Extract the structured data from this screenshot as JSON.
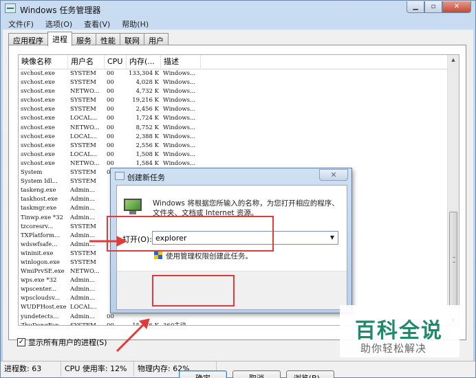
{
  "window": {
    "title": "Windows 任务管理器",
    "icon": "task-manager-icon"
  },
  "caption_buttons": [
    "▁",
    "▫",
    "✕"
  ],
  "menu": [
    "文件(F)",
    "选项(O)",
    "查看(V)",
    "帮助(H)"
  ],
  "tabs": [
    {
      "label": "应用程序",
      "active": false
    },
    {
      "label": "进程",
      "active": true
    },
    {
      "label": "服务",
      "active": false
    },
    {
      "label": "性能",
      "active": false
    },
    {
      "label": "联网",
      "active": false
    },
    {
      "label": "用户",
      "active": false
    }
  ],
  "columns": [
    "映像名称",
    "用户名",
    "CPU",
    "内存(...",
    "描述"
  ],
  "processes": [
    [
      "svchost.exe",
      "SYSTEM",
      "00",
      "133,304 K",
      "Windows..."
    ],
    [
      "svchost.exe",
      "SYSTEM",
      "00",
      "4,028 K",
      "Windows..."
    ],
    [
      "svchost.exe",
      "NETWO...",
      "00",
      "4,732 K",
      "Windows..."
    ],
    [
      "svchost.exe",
      "SYSTEM",
      "00",
      "19,216 K",
      "Windows..."
    ],
    [
      "svchost.exe",
      "SYSTEM",
      "00",
      "2,456 K",
      "Windows..."
    ],
    [
      "svchost.exe",
      "LOCAL...",
      "00",
      "1,724 K",
      "Windows..."
    ],
    [
      "svchost.exe",
      "NETWO...",
      "00",
      "8,752 K",
      "Windows..."
    ],
    [
      "svchost.exe",
      "LOCAL...",
      "00",
      "2,388 K",
      "Windows..."
    ],
    [
      "svchost.exe",
      "SYSTEM",
      "00",
      "2,556 K",
      "Windows..."
    ],
    [
      "svchost.exe",
      "LOCAL...",
      "00",
      "1,508 K",
      "Windows..."
    ],
    [
      "svchost.exe",
      "NETWO...",
      "00",
      "1,584 K",
      "Windows..."
    ],
    [
      "System",
      "SYSTEM",
      "00",
      "",
      ""
    ],
    [
      "System Idl...",
      "SYSTEM",
      "",
      "",
      ""
    ],
    [
      "taskeng.exe",
      "Admin...",
      "",
      "",
      ""
    ],
    [
      "taskhost.exe",
      "Admin...",
      "",
      "",
      ""
    ],
    [
      "taskmgr.exe",
      "Admin...",
      "",
      "",
      ""
    ],
    [
      "Tinwp.exe *32",
      "Admin...",
      "",
      "",
      ""
    ],
    [
      "tzcoresrv...",
      "SYSTEM",
      "",
      "",
      ""
    ],
    [
      "TXPlatform...",
      "Admin...",
      "",
      "",
      ""
    ],
    [
      "wdswfsafe...",
      "Admin...",
      "",
      "",
      ""
    ],
    [
      "wininit.exe",
      "SYSTEM",
      "",
      "",
      ""
    ],
    [
      "winlogon.exe",
      "SYSTEM",
      "",
      "",
      ""
    ],
    [
      "WmiPrvSE.exe",
      "NETWO...",
      "",
      "",
      ""
    ],
    [
      "wps.exe *32",
      "Admin...",
      "",
      "",
      ""
    ],
    [
      "wpscenter...",
      "Admin...",
      "",
      "",
      ""
    ],
    [
      "wpscloudsv...",
      "Admin...",
      "",
      "",
      ""
    ],
    [
      "WUDFHost.exe",
      "LOCAL...",
      "",
      "",
      ""
    ],
    [
      "yundetects...",
      "Admin...",
      "00",
      "",
      ""
    ],
    [
      "ZhuDongFan...",
      "SYSTEM",
      "00",
      "15,576 K",
      "360主动..."
    ]
  ],
  "show_all_users": {
    "label": "显示所有用户的进程(S)",
    "checked": true,
    "mark": "✓"
  },
  "status": [
    "进程数: 63",
    "CPU 使用率: 12%",
    "物理内存: 62%"
  ],
  "run_dialog": {
    "title": "创建新任务",
    "close_label": "✕",
    "description": "Windows 将根据您所输入的名称，为您打开相应的程序、文件夹、文档或 Internet 资源。",
    "open_label": "打开(O):",
    "open_value": "explorer",
    "dropdown_glyph": "▼",
    "admin_label": "使用管理权限创建此任务。",
    "ok": "确定",
    "cancel": "取消",
    "browse": "浏览(B)..."
  },
  "annotation_color": "#e23a3a",
  "watermark": {
    "title": "百科全说",
    "subtitle": "助你轻松解决"
  }
}
